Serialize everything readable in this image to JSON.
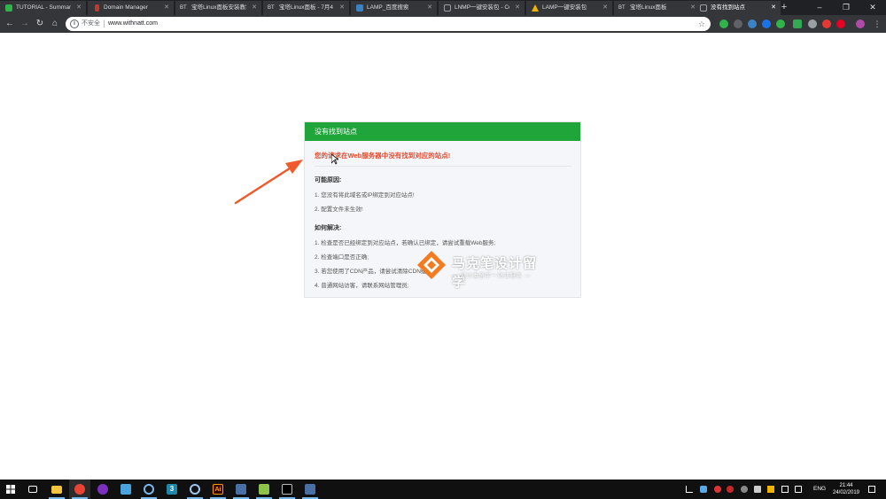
{
  "browser": {
    "tabs": [
      {
        "title": "TUTORIAL - Summary |",
        "favicon_color": "#2fb34a"
      },
      {
        "title": "Domain Manager",
        "favicon_color": "#c0392b"
      },
      {
        "title": "宝塔Linux面板安装教程",
        "prefix": "BT"
      },
      {
        "title": "宝塔Linux面板 - 7月4日",
        "prefix": "BT"
      },
      {
        "title": "LAMP_百度搜索",
        "favicon_color": "#3b82c4"
      },
      {
        "title": "LNMP一键安装包 - Cen",
        "favicon_color": "#9aa0a6"
      },
      {
        "title": "LAMP一键安装包",
        "favicon_color": "#f0b400"
      },
      {
        "title": "宝塔Linux面板",
        "prefix": "BT"
      },
      {
        "title": "没有找到站点",
        "favicon_color": "#9aa0a6",
        "active": true
      }
    ],
    "new_tab": "+",
    "window_controls": {
      "minimize": "–",
      "maximize": "❐",
      "close": "✕"
    },
    "nav": {
      "back": "←",
      "forward": "→",
      "reload": "↻",
      "home": "⌂"
    },
    "address": {
      "security_label": "不安全",
      "url": "www.withnatt.com",
      "info": "i",
      "star": "☆"
    }
  },
  "page": {
    "header": "没有找到站点",
    "error_message": "您的请求在Web服务器中没有找到对应的站点!",
    "reasons_title": "可能原因:",
    "reasons": [
      "1. 您没有将此域名或IP绑定到对应站点!",
      "2. 配置文件未生效!"
    ],
    "solutions_title": "如何解决:",
    "solutions": [
      "1. 检查是否已经绑定到对应站点，若确认已绑定，请尝试重载Web服务;",
      "2. 检查端口是否正确;",
      "3. 若您使用了CDN产品，请尝试清除CDN缓存;",
      "4. 普通网站访客，请联系网站管理员;"
    ]
  },
  "watermark": {
    "title": "马克笔设计留学",
    "subtitle": "— 设计类留学一站式服务 —"
  },
  "taskbar": {
    "language": "ENG",
    "time": "21:44",
    "date": "24/02/2019",
    "apps": [
      "windows-start",
      "task-view",
      "file-explorer",
      "chrome",
      "firefox",
      "bird-app",
      "cortana",
      "3d-app",
      "settings-app",
      "illustrator",
      "network-app",
      "notepad",
      "terminal",
      "network-app-2"
    ]
  },
  "colors": {
    "header_green": "#20a53a",
    "error_red": "#e64b2e",
    "arrow_red": "#f05a2b",
    "watermark_orange": "#f47b20"
  }
}
